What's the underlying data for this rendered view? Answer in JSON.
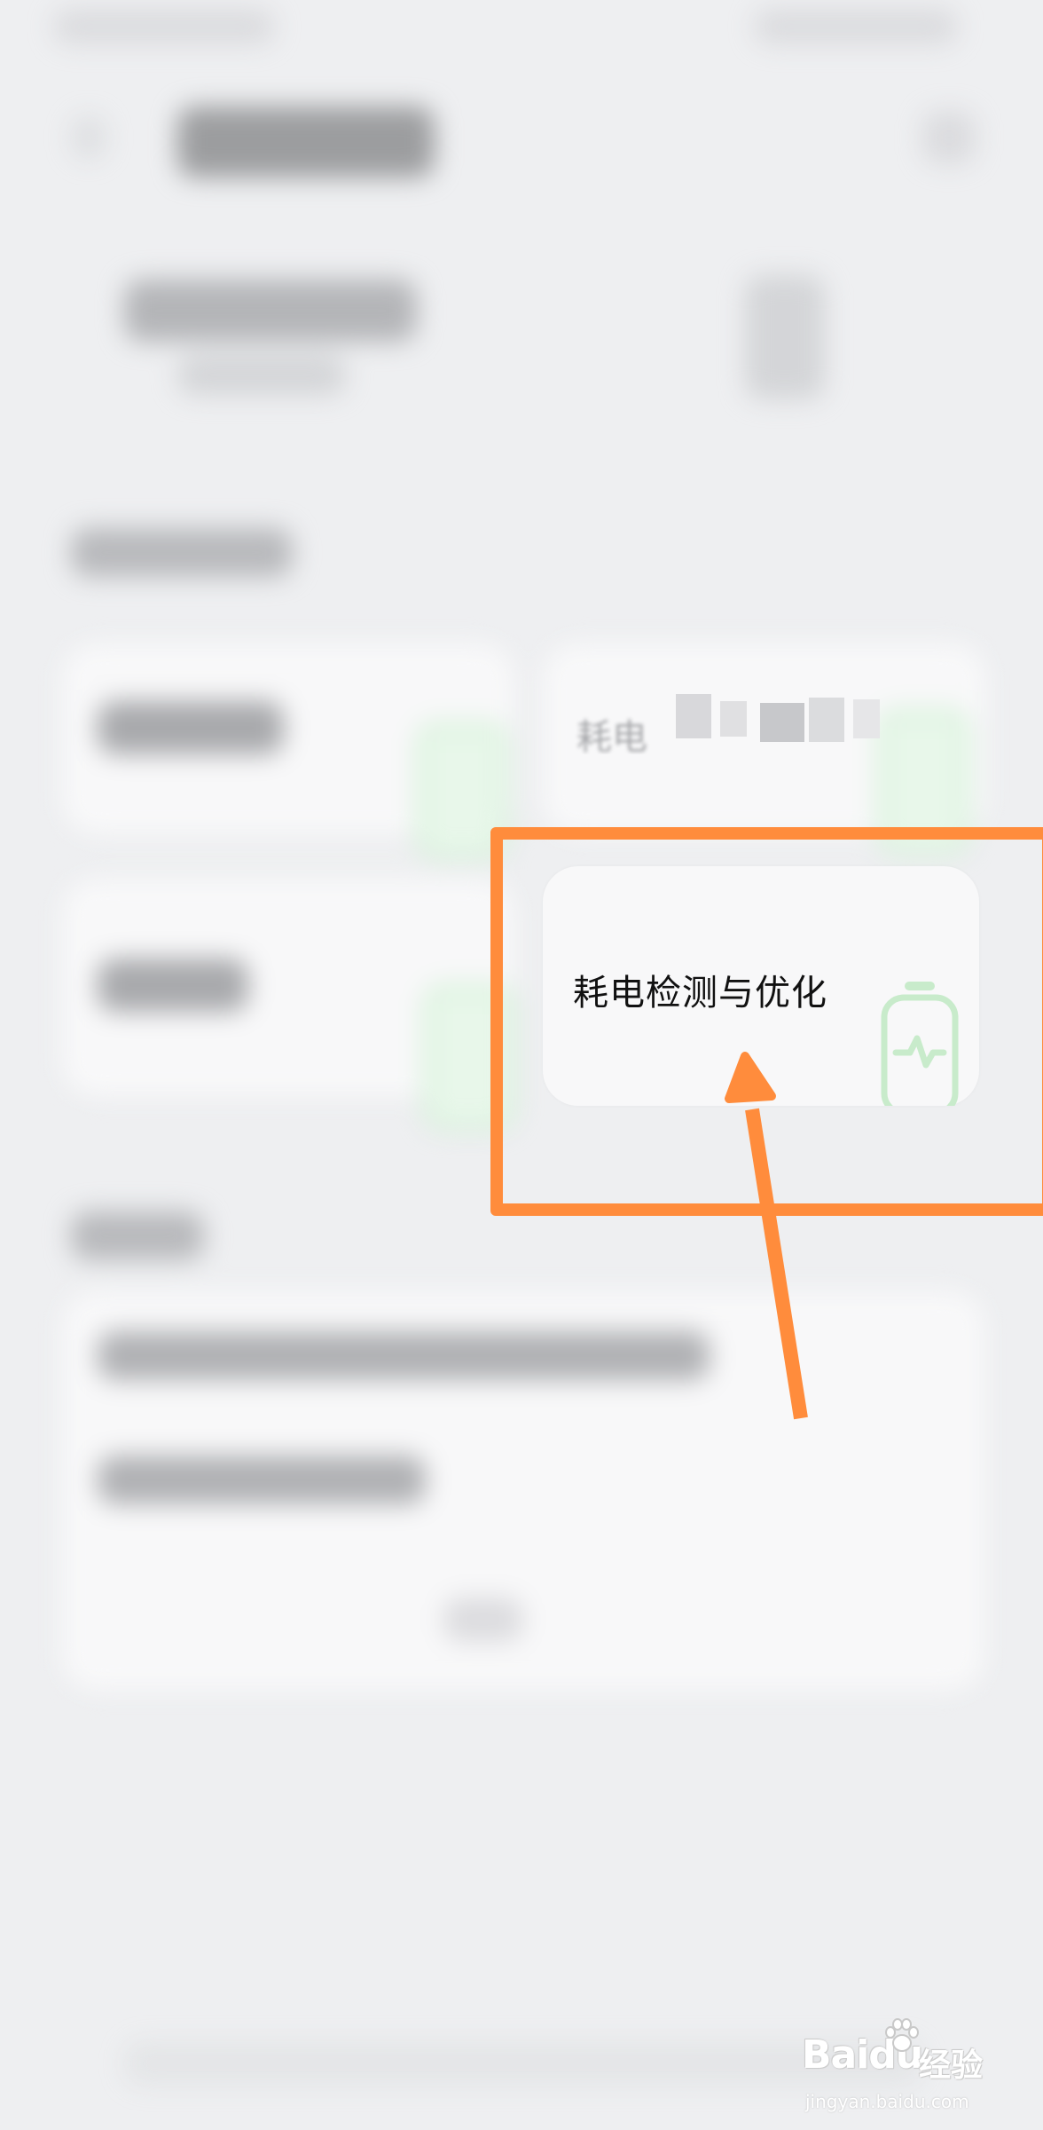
{
  "cards": {
    "power_consumption_detection": {
      "title": "耗电检测与优化",
      "icon": "battery-pulse-icon"
    },
    "partial_card_above": {
      "title_fragment": "耗电"
    }
  },
  "annotation": {
    "highlight_color": "#ff8c3c",
    "arrow_color": "#ff8c3c"
  },
  "watermark": {
    "brand": "Baidu",
    "product": "经验",
    "url": "jingyan.baidu.com"
  },
  "colors": {
    "background": "#eeeff1",
    "card": "#f8f8f9",
    "accent_green": "#4cc35a"
  }
}
